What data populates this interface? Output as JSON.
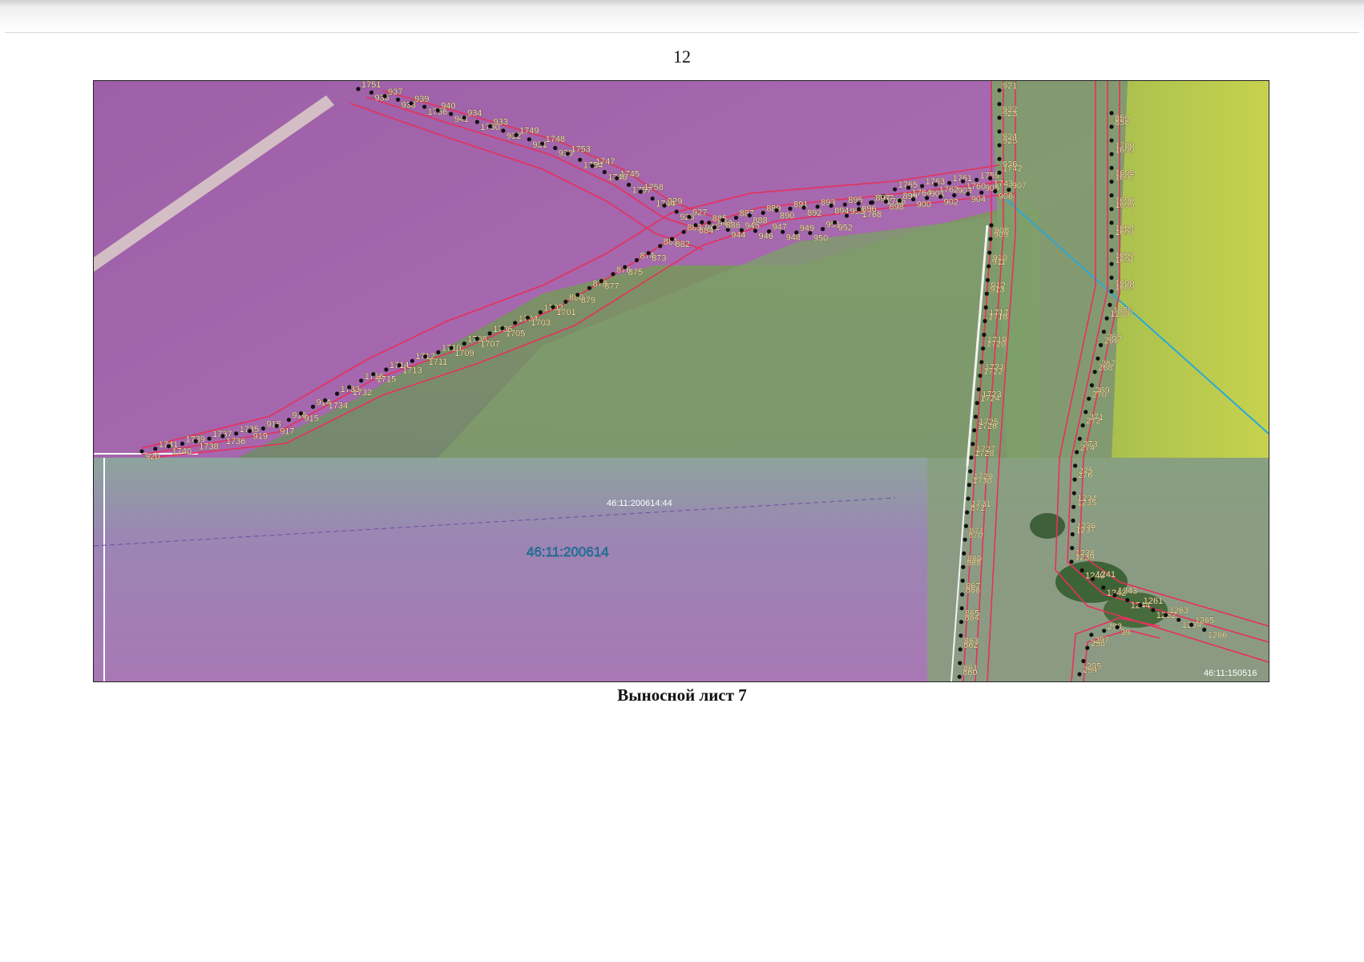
{
  "page": {
    "number": "12",
    "caption": "Выносной лист 7"
  },
  "map": {
    "colors": {
      "boundary": "#e8305a",
      "point": "#111111",
      "road": "#f2f2f2",
      "cadastral": "#2aa8d8"
    },
    "cadastral_labels": [
      {
        "id": "parcel",
        "text": "46:11:200614:44"
      },
      {
        "id": "quarter",
        "text": "46:11:200614"
      },
      {
        "id": "edge",
        "text": "46:11:150516"
      }
    ],
    "points": [
      "1751",
      "936",
      "937",
      "938",
      "939",
      "1756",
      "940",
      "941",
      "934",
      "1750",
      "933",
      "932",
      "1749",
      "931",
      "1748",
      "930",
      "1753",
      "1754",
      "1747",
      "1746",
      "1745",
      "1757",
      "1758",
      "1744",
      "929",
      "928",
      "927",
      "942",
      "943",
      "944",
      "945",
      "946",
      "947",
      "948",
      "949",
      "950",
      "951",
      "952",
      "953",
      "1768",
      "1767",
      "1766",
      "1765",
      "1764",
      "1763",
      "1762",
      "1761",
      "1760",
      "1759",
      "1743",
      "1742",
      "926",
      "925",
      "924",
      "923",
      "922",
      "921",
      "920",
      "1741",
      "1740",
      "1739",
      "1738",
      "1737",
      "1736",
      "1735",
      "919",
      "918",
      "917",
      "916",
      "915",
      "914",
      "1734",
      "1733",
      "1732",
      "1716",
      "1715",
      "1714",
      "1713",
      "1712",
      "1711",
      "1710",
      "1709",
      "1708",
      "1707",
      "1706",
      "1705",
      "1704",
      "1703",
      "1702",
      "1701",
      "880",
      "879",
      "878",
      "877",
      "876",
      "875",
      "874",
      "873",
      "881",
      "882",
      "883",
      "884",
      "885",
      "886",
      "887",
      "888",
      "889",
      "890",
      "891",
      "892",
      "893",
      "894",
      "895",
      "896",
      "897",
      "898",
      "899",
      "900",
      "901",
      "902",
      "903",
      "904",
      "905",
      "906",
      "907",
      "908",
      "909",
      "910",
      "911",
      "912",
      "913",
      "1717",
      "1718",
      "1719",
      "1720",
      "1721",
      "1722",
      "1723",
      "1724",
      "1725",
      "1726",
      "1727",
      "1728",
      "1729",
      "1730",
      "1731",
      "872",
      "871",
      "870",
      "869",
      "868",
      "867",
      "866",
      "865",
      "864",
      "863",
      "862",
      "861",
      "860",
      "859",
      "858",
      "1700",
      "1699",
      "1698",
      "1697",
      "1696",
      "1695",
      "1694",
      "1693",
      "1692",
      "1691",
      "1690",
      "1689",
      "1688",
      "1233",
      "265",
      "266",
      "267",
      "268",
      "269",
      "270",
      "271",
      "272",
      "273",
      "274",
      "275",
      "276",
      "1234",
      "1235",
      "1236",
      "1237",
      "1238",
      "1239",
      "1240",
      "1241",
      "1242",
      "1243",
      "1244",
      "1261",
      "1262",
      "1263",
      "1264",
      "1265",
      "1266",
      "294",
      "295",
      "296",
      "297",
      "298",
      "39"
    ]
  }
}
